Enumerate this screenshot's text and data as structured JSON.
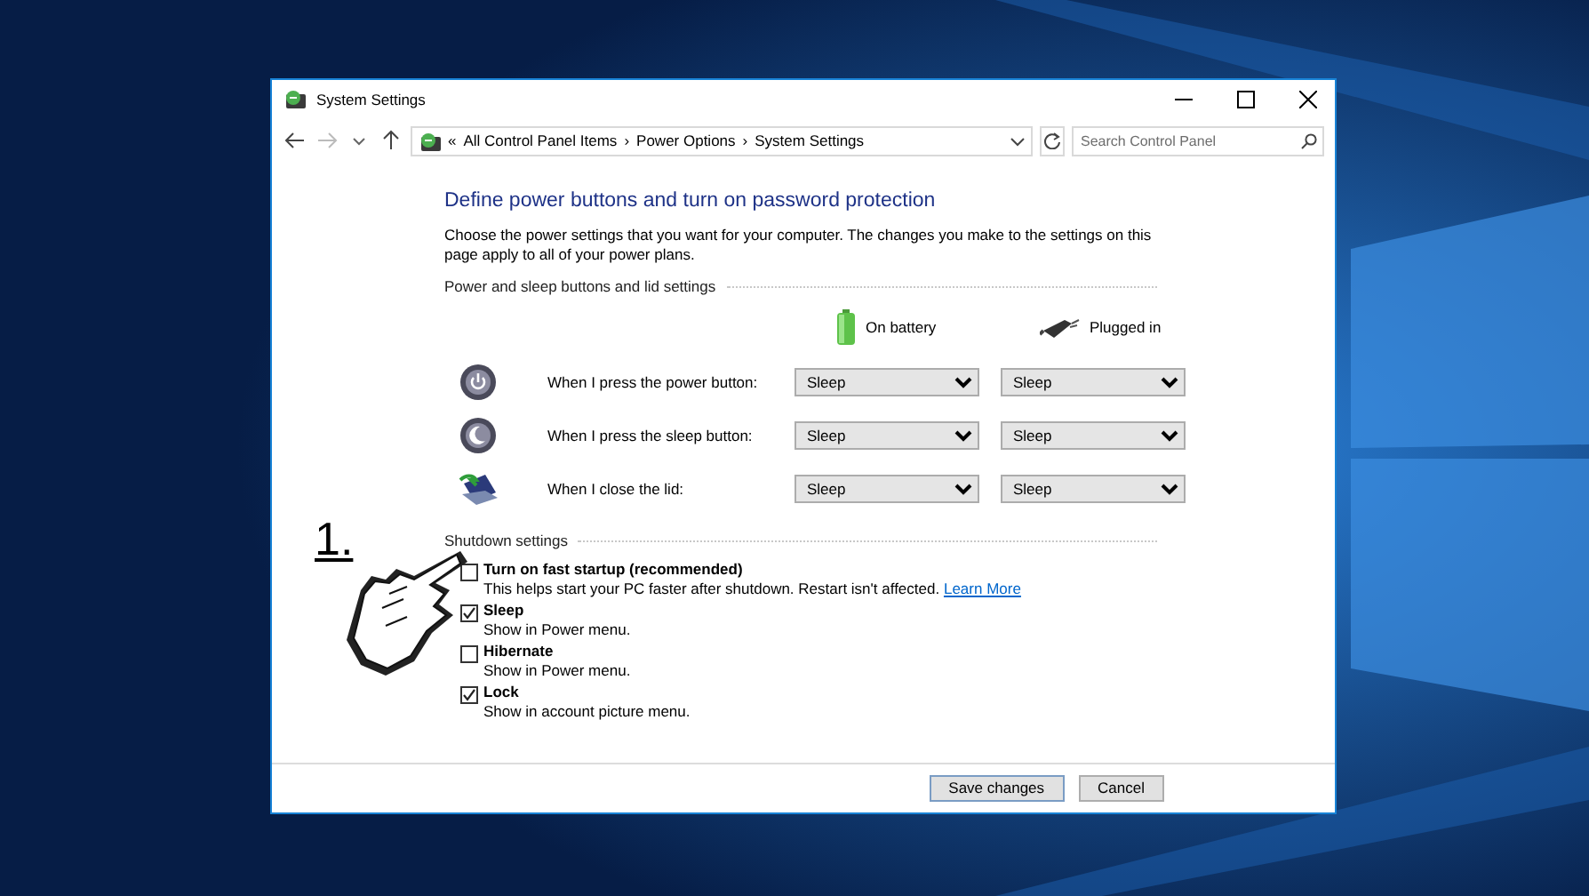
{
  "window": {
    "title": "System Settings"
  },
  "address_bar": {
    "prefix": "«",
    "crumbs": [
      "All Control Panel Items",
      "Power Options",
      "System Settings"
    ],
    "separator": "›"
  },
  "search": {
    "placeholder": "Search Control Panel"
  },
  "heading": "Define power buttons and turn on password protection",
  "description": "Choose the power settings that you want for your computer. The changes you make to the settings on this page apply to all of your power plans.",
  "power_section": {
    "title": "Power and sleep buttons and lid settings",
    "columns": [
      {
        "label": "On battery",
        "kind": "battery"
      },
      {
        "label": "Plugged in",
        "kind": "plug"
      }
    ],
    "rows": [
      {
        "kind": "power",
        "label": "When I press the power button:",
        "values": [
          "Sleep",
          "Sleep"
        ]
      },
      {
        "kind": "sleep",
        "label": "When I press the sleep button:",
        "values": [
          "Sleep",
          "Sleep"
        ]
      },
      {
        "kind": "lid",
        "label": "When I close the lid:",
        "values": [
          "Sleep",
          "Sleep"
        ]
      }
    ]
  },
  "shutdown_section": {
    "title": "Shutdown settings",
    "options": [
      {
        "label": "Turn on fast startup (recommended)",
        "description": "This helps start your PC faster after shutdown. Restart isn't affected.",
        "link": "Learn More",
        "checked": false
      },
      {
        "label": "Sleep",
        "description": "Show in Power menu.",
        "checked": true
      },
      {
        "label": "Hibernate",
        "description": "Show in Power menu.",
        "checked": false
      },
      {
        "label": "Lock",
        "description": "Show in account picture menu.",
        "checked": true
      }
    ]
  },
  "buttons": [
    "Save changes",
    "Cancel"
  ],
  "annotation": {
    "step": "1."
  }
}
